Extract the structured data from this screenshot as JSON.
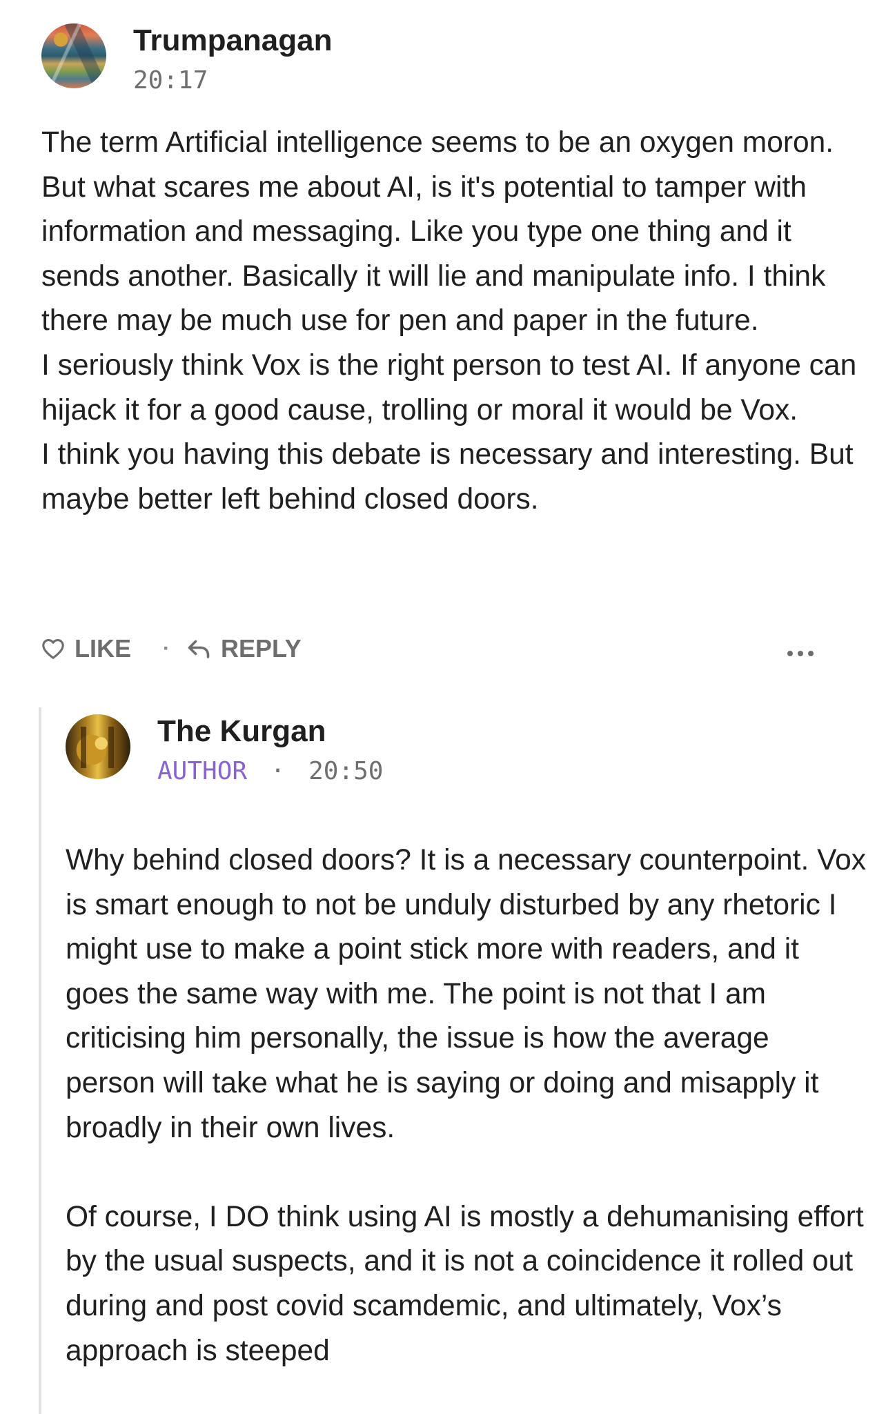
{
  "comment": {
    "author": "Trumpanagan",
    "time": "20:17",
    "paragraphs": [
      "The term Artificial intelligence seems to be an oxygen moron. But what scares me about AI, is it's potential to tamper with information and messaging. Like you type one thing and it sends another. Basically it will lie and manipulate info. I think there may be much use for pen and paper in the future.",
      "I seriously think Vox is the right person to test AI. If anyone can hijack it for a good cause, trolling or moral it would be Vox.",
      "I think you having this debate is necessary and interesting. But maybe better left behind closed doors."
    ],
    "actions": {
      "like_label": "LIKE",
      "separator": "·",
      "reply_label": "REPLY",
      "more_icon": "more-dots-icon"
    }
  },
  "reply": {
    "author": "The Kurgan",
    "badge": "AUTHOR",
    "separator": "·",
    "time": "20:50",
    "paragraphs": [
      "Why behind closed doors? It is a necessary counterpoint. Vox is smart enough to not be unduly disturbed by any rhetoric I might use to make a point stick more with readers, and it goes the same way with me. The point is not that I am criticising him personally, the issue is how the average person will take what he is saying or doing and misapply it broadly in their own lives.",
      "Of course, I DO think using AI is mostly a dehumanising effort by the usual suspects, and it is not a coincidence it rolled out during and post covid scamdemic, and ultimately, Vox’s approach is steeped"
    ]
  },
  "colors": {
    "badge": "#8a63d2",
    "meta": "#6f6f6f",
    "thread_line": "#e2e2e2"
  }
}
